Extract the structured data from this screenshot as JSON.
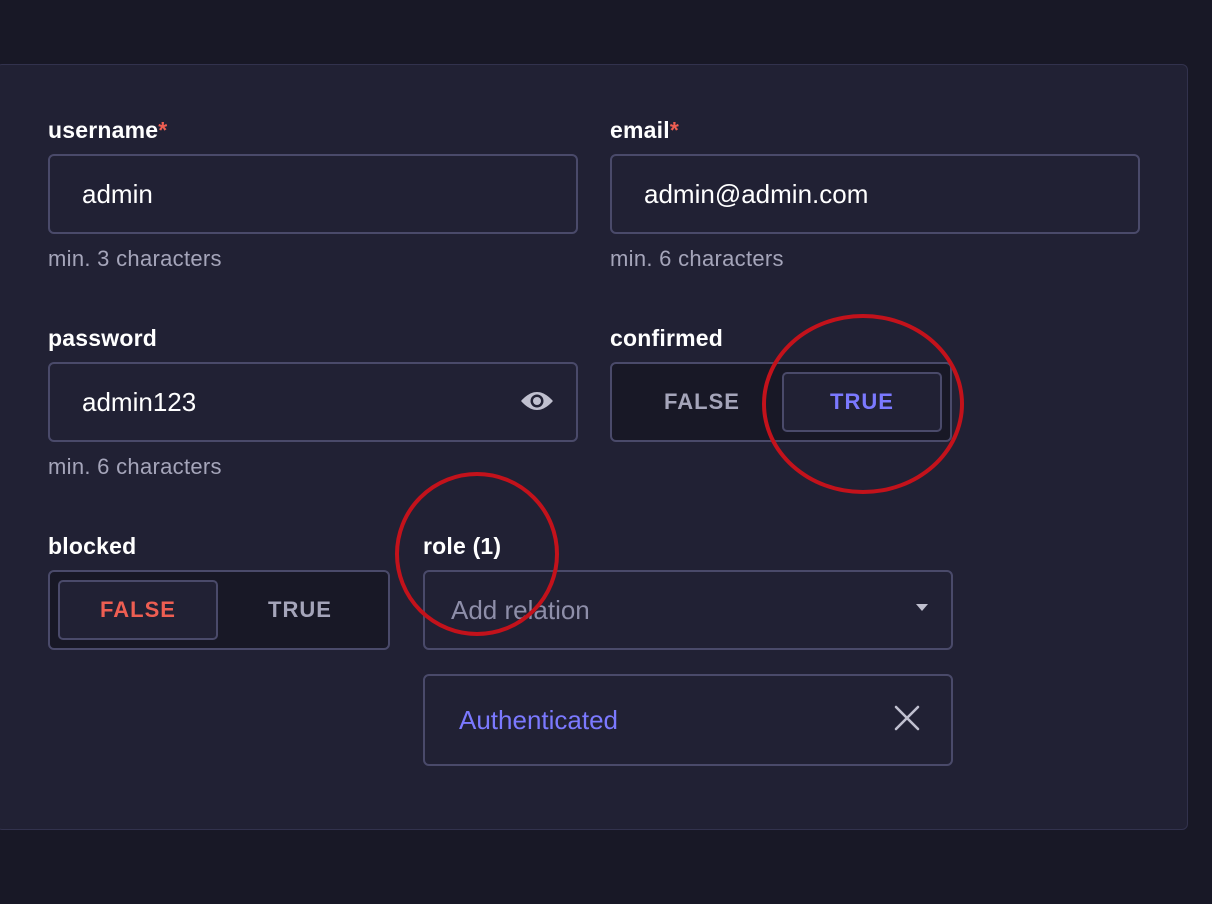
{
  "fields": {
    "username": {
      "label": "username",
      "required_mark": "*",
      "value": "admin",
      "hint": "min. 3 characters"
    },
    "email": {
      "label": "email",
      "required_mark": "*",
      "value": "admin@admin.com",
      "hint": "min. 6 characters"
    },
    "password": {
      "label": "password",
      "value": "admin123",
      "hint": "min. 6 characters",
      "toggle_icon": "eye-icon"
    },
    "confirmed": {
      "label": "confirmed",
      "false_label": "FALSE",
      "true_label": "TRUE",
      "selected": "TRUE"
    },
    "blocked": {
      "label": "blocked",
      "false_label": "FALSE",
      "true_label": "TRUE",
      "selected": "FALSE"
    },
    "role": {
      "label": "role (1)",
      "placeholder": "Add relation",
      "selected_item": "Authenticated",
      "dropdown_icon": "caret-down-icon",
      "remove_icon": "close-icon"
    }
  },
  "colors": {
    "page_bg": "#181826",
    "card_bg": "#212134",
    "border": "#4a4a6a",
    "required": "#ee5e52",
    "primary": "#7b79ff",
    "danger": "#ee5e52",
    "muted": "#a5a5ba",
    "annotation_circle": "#c3121b"
  }
}
